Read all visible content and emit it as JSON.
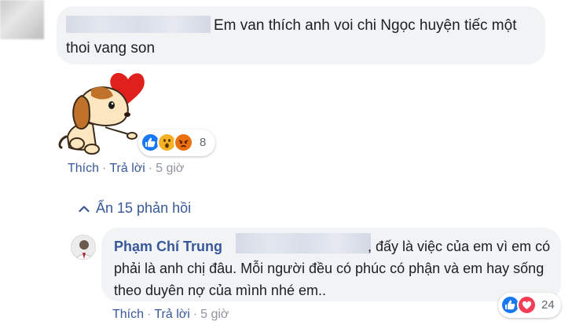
{
  "comment1": {
    "text": "Em van thích anh voi chi Ngọc huyện tiếc một thoi vang son",
    "sticker": "dog-heart-sticker",
    "reactions": {
      "icons": [
        "like-icon",
        "wow-icon",
        "angry-icon"
      ],
      "count": "8"
    },
    "actions": {
      "like": "Thích",
      "reply": "Trả lời",
      "time": "5 giờ",
      "separator": "·"
    }
  },
  "replies_toggle": {
    "label": "Ẩn 15 phản hồi",
    "icon": "chevron-up-icon"
  },
  "comment2": {
    "author": "Phạm Chí Trung",
    "text": ", đấy là việc của em vì em có phải là anh chị đâu. Mỗi người đều có phúc có phận và em hay sống theo duyên nợ của mình nhé em..",
    "reactions": {
      "icons": [
        "like-icon",
        "love-icon"
      ],
      "count": "24"
    },
    "actions": {
      "like": "Thích",
      "reply": "Trả lời",
      "time": "5 giờ",
      "separator": "·"
    }
  },
  "colors": {
    "link": "#385898",
    "bubble": "#f2f3f5",
    "like": "#1877f2",
    "love": "#f33e58",
    "wow": "#f7b125",
    "angry": "#e9710f"
  }
}
